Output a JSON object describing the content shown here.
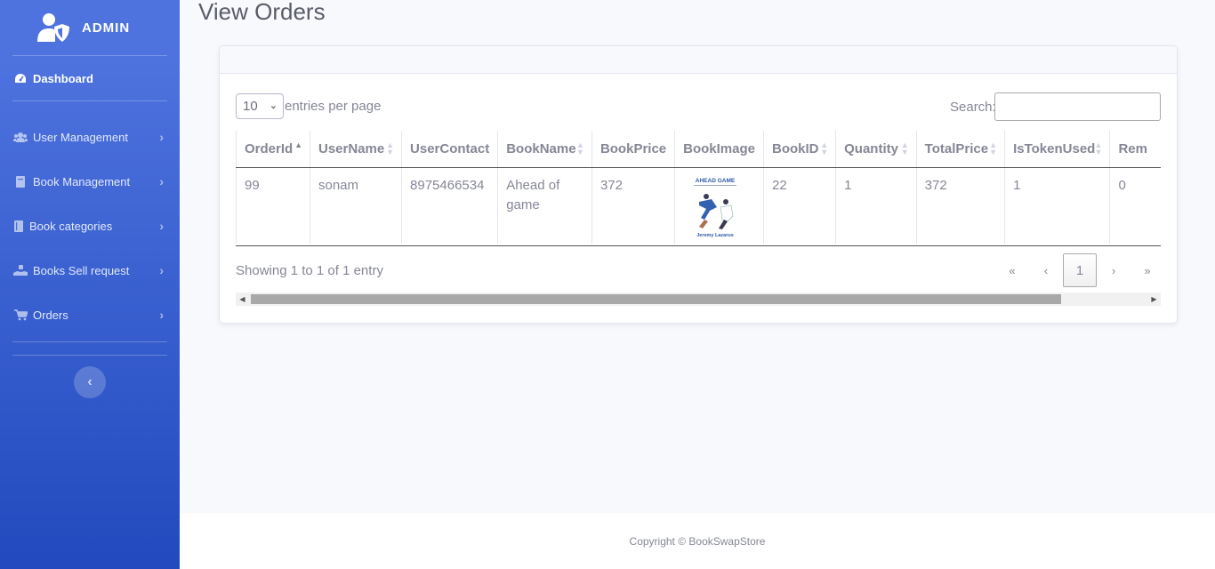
{
  "sidebar": {
    "brand": "ADMIN",
    "items": [
      {
        "label": "Dashboard",
        "icon": "tachometer-icon"
      },
      {
        "label": "User Management",
        "icon": "users-icon"
      },
      {
        "label": "Book Management",
        "icon": "book-icon"
      },
      {
        "label": "Book categories",
        "icon": "book-icon"
      },
      {
        "label": "Books Sell request",
        "icon": "hand-holding-icon"
      },
      {
        "label": "Orders",
        "icon": "cart-icon"
      }
    ],
    "toggle": "‹"
  },
  "page": {
    "title": "View Orders"
  },
  "table_controls": {
    "entries_value": "10",
    "entries_label": "entries per page",
    "search_label": "Search:",
    "search_value": ""
  },
  "table": {
    "columns": [
      "OrderId",
      "UserName",
      "UserContact",
      "BookName",
      "BookPrice",
      "BookImage",
      "BookID",
      "Quantity",
      "TotalPrice",
      "IsTokenUsed",
      "Rem"
    ],
    "rows": [
      {
        "OrderId": "99",
        "UserName": "sonam",
        "UserContact": "8975466534",
        "BookName": "Ahead of game",
        "BookPrice": "372",
        "BookImage": {
          "title": "AHEAD GAME",
          "author": "Jeremy Lazarus"
        },
        "BookID": "22",
        "Quantity": "1",
        "TotalPrice": "372",
        "IsTokenUsed": "1",
        "Rem": "0"
      }
    ]
  },
  "pagination": {
    "info": "Showing 1 to 1 of 1 entry",
    "first": "«",
    "prev": "‹",
    "current": "1",
    "next": "›",
    "last": "»"
  },
  "footer": {
    "copyright": "Copyright © BookSwapStore"
  },
  "colors": {
    "sidebar_start": "#4e73df",
    "sidebar_end": "#224abe",
    "text_muted": "#858796"
  }
}
